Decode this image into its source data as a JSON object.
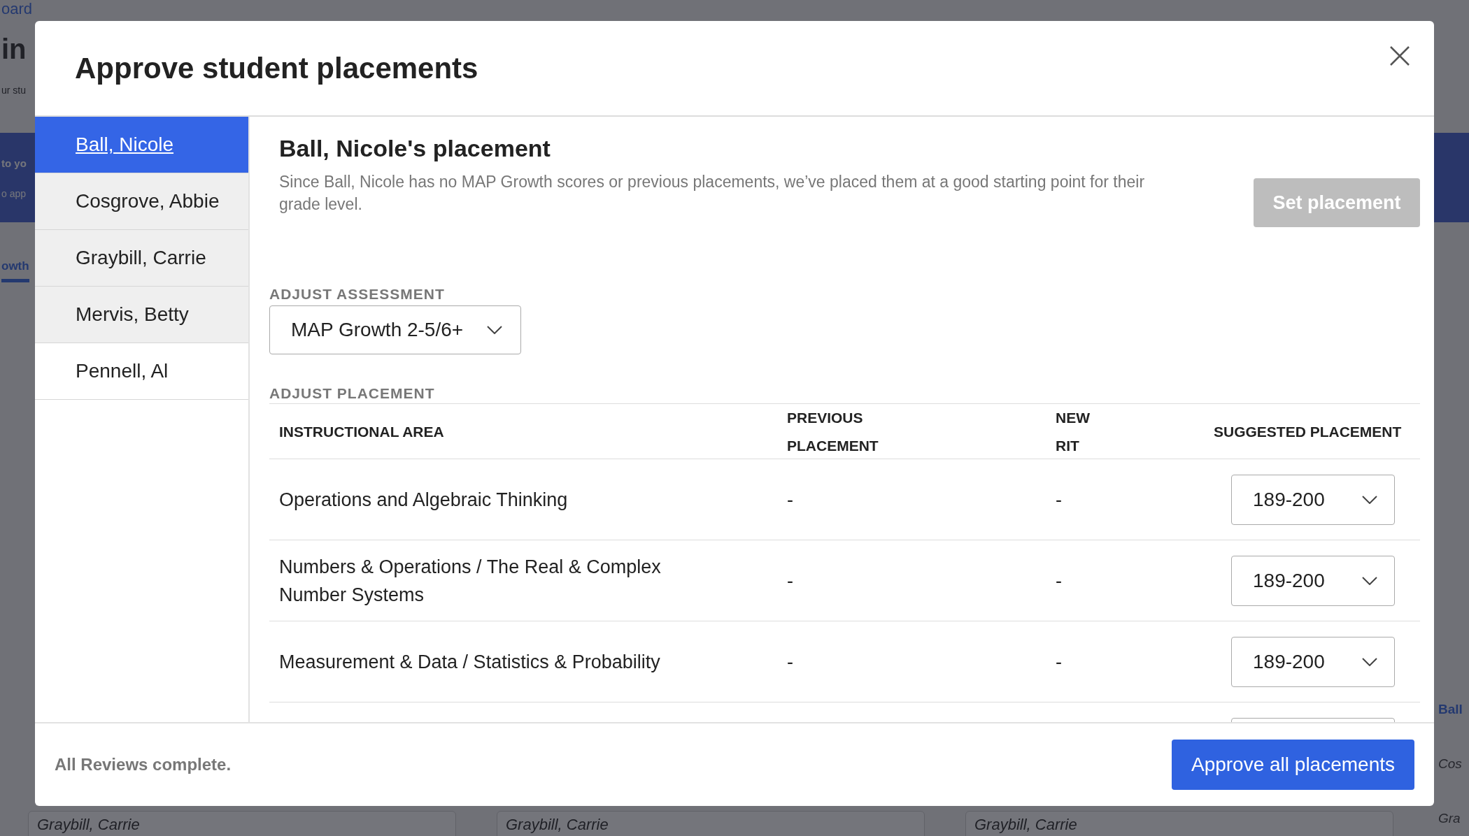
{
  "background": {
    "breadcrumb": "oard",
    "heading": "in",
    "subtitle": "ur stu",
    "banner_title": "to yo",
    "banner_text": "o app",
    "tab": "owth",
    "right_rows": [
      "Ball",
      "Cos",
      "Gra"
    ],
    "bottom_cards": [
      "Graybill, Carrie",
      "Graybill, Carrie",
      "Graybill, Carrie"
    ]
  },
  "modal": {
    "title": "Approve student placements",
    "students": [
      {
        "name": "Ball, Nicole",
        "selected": true,
        "reviewed": false
      },
      {
        "name": "Cosgrove, Abbie",
        "selected": false,
        "reviewed": true
      },
      {
        "name": "Graybill, Carrie",
        "selected": false,
        "reviewed": true
      },
      {
        "name": "Mervis, Betty",
        "selected": false,
        "reviewed": true
      },
      {
        "name": "Pennell, Al",
        "selected": false,
        "reviewed": false
      }
    ],
    "placement": {
      "heading": "Ball, Nicole's placement",
      "description": "Since Ball, Nicole has no MAP Growth scores or previous placements, we’ve placed them at a good starting point for their grade level.",
      "set_button": {
        "label": "Set placement",
        "disabled": true
      },
      "assessment_label": "ADJUST ASSESSMENT",
      "assessment": "MAP Growth 2-5/6+",
      "placement_label": "ADJUST PLACEMENT",
      "columns": [
        "INSTRUCTIONAL AREA",
        "PREVIOUS PLACEMENT",
        "NEW RIT",
        "SUGGESTED PLACEMENT"
      ],
      "rows": [
        {
          "area": "Operations and Algebraic Thinking",
          "previous": "-",
          "new_rit": "-",
          "suggested": "189-200"
        },
        {
          "area": "Numbers & Operations / The Real & Complex Number Systems",
          "previous": "-",
          "new_rit": "-",
          "suggested": "189-200"
        },
        {
          "area": "Measurement & Data / Statistics & Probability",
          "previous": "-",
          "new_rit": "-",
          "suggested": "189-200"
        }
      ]
    },
    "footer": {
      "status": "All Reviews complete.",
      "approve_button": "Approve all placements"
    }
  }
}
